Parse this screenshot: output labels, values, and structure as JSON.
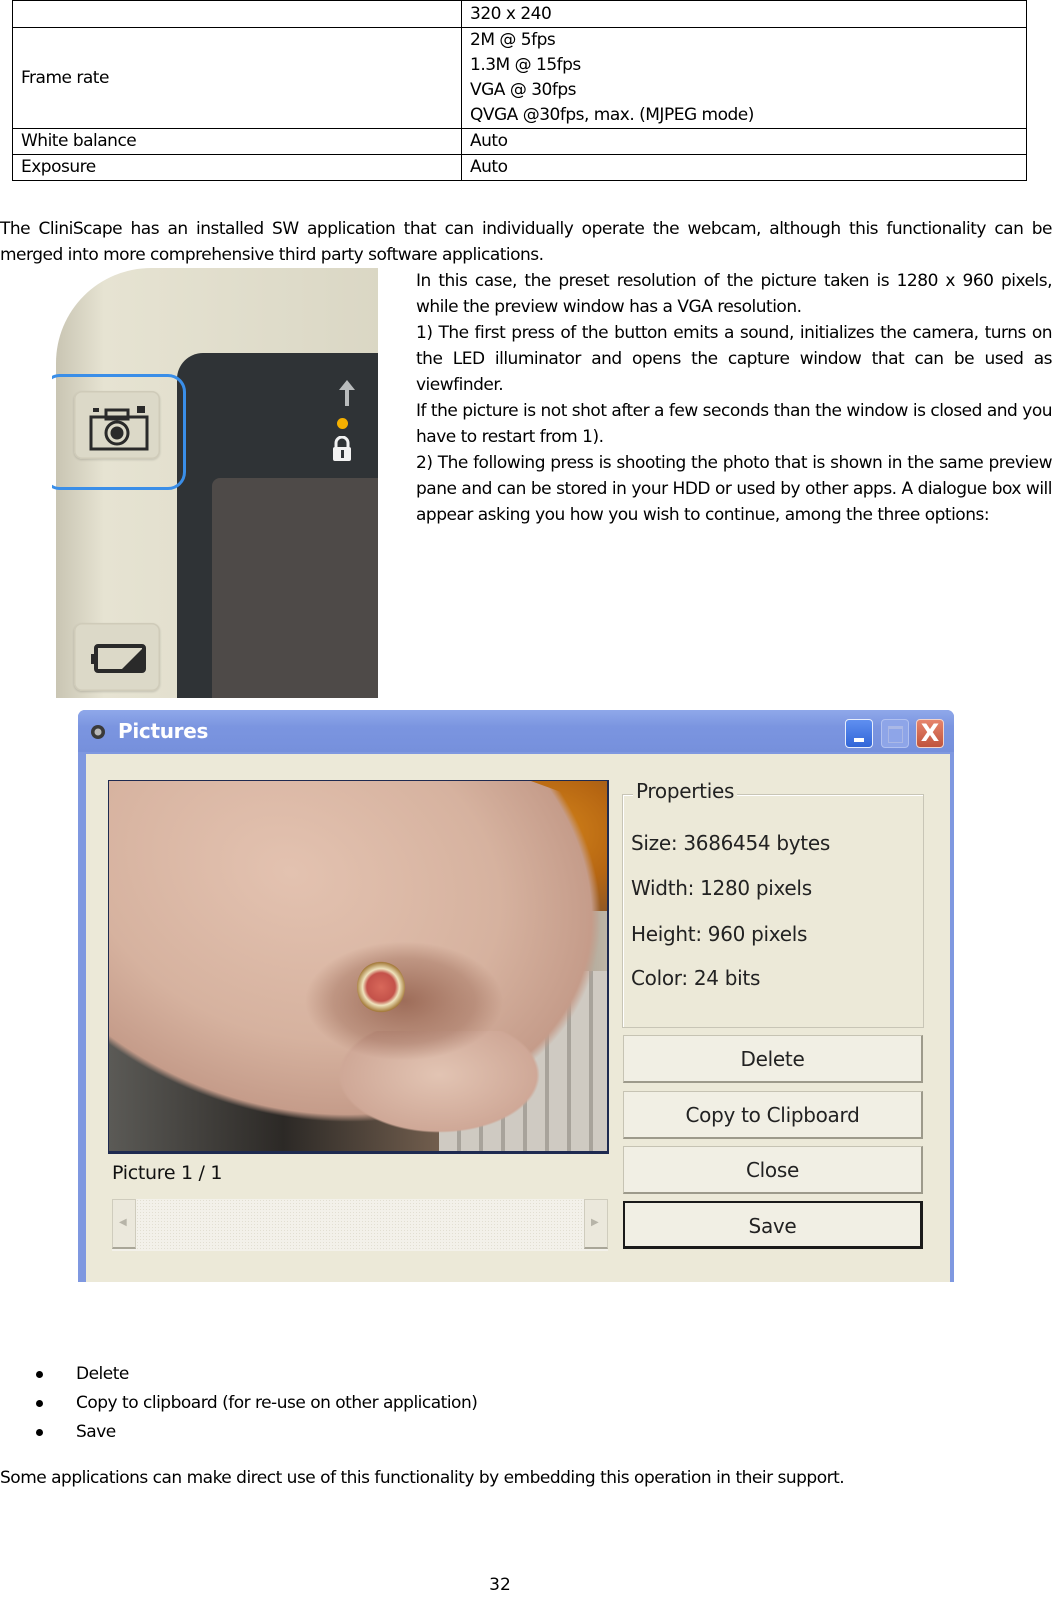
{
  "spec_table": {
    "rows": [
      {
        "label": "",
        "values": [
          "320 x 240"
        ]
      },
      {
        "label": "Frame rate",
        "values": [
          "2M @  5fps",
          "1.3M @  15fps",
          "VGA @  30fps",
          "QVGA @30fps, max. (MJPEG mode)"
        ]
      },
      {
        "label": "White balance",
        "values": [
          "Auto"
        ]
      },
      {
        "label": "Exposure",
        "values": [
          "Auto"
        ]
      }
    ]
  },
  "intro": "The CliniScape has an installed SW  application that can individually operate the webcam, although this functionality can be merged into more comprehensive third party  software applications.",
  "right_column": [
    "In this case, the preset resolution of the picture taken is 1280 x 960 pixels, while the preview window has a VGA resolution.",
    "1) The first press of the button emits a sound, initializes the camera, turns on the LED illuminator and opens the capture window that can be used as viewfinder.",
    "If the picture is not shot after a few seconds than the window is closed and you have to restart from 1).",
    "2) The following press is shooting the photo that is shown in the same preview pane and can be stored in your HDD or used by other apps. A dialogue box will appear asking you  how you wish to continue, among the three options:"
  ],
  "device_illustration": {
    "icons": [
      "camera-icon",
      "battery-icon",
      "arrow-up-icon",
      "led-indicator",
      "lock-icon"
    ],
    "highlight_color": "#3a8ee8",
    "led_color": "#f5b000"
  },
  "dialog": {
    "title": "Pictures",
    "title_buttons": {
      "minimize": "minimize",
      "maximize": "maximize",
      "close": "X"
    },
    "picture_label": "Picture 1 / 1",
    "properties": {
      "legend": "Properties",
      "size": "Size: 3686454 bytes",
      "width": "Width: 1280 pixels",
      "height": "Height: 960 pixels",
      "color": "Color: 24 bits"
    },
    "buttons": {
      "delete": "Delete",
      "copy": "Copy to Clipboard",
      "close": "Close",
      "save": "Save"
    },
    "scroll_arrows": {
      "left": "◀",
      "right": "▶"
    },
    "colors": {
      "titlebar": "#7b95e0",
      "body": "#ece9d8",
      "close_button": "#c0543d"
    }
  },
  "options_list": [
    "Delete",
    "Copy to clipboard (for re-use on other application)",
    "Save"
  ],
  "closing": "Some applications can make direct use of this functionality by embedding this operation in their support.",
  "page_number": "32"
}
